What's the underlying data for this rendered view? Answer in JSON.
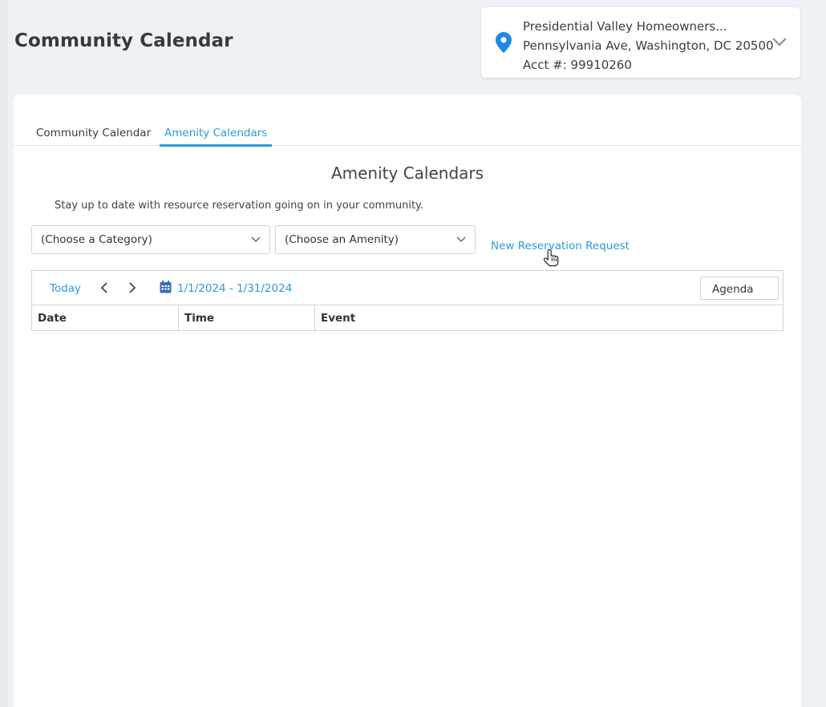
{
  "page": {
    "title": "Community Calendar"
  },
  "account": {
    "name": "Presidential Valley Homeowners...",
    "address": "Pennsylvania Ave, Washington, DC 20500",
    "acct": "Acct #: 99910260",
    "pin_color": "#1e88e5"
  },
  "tabs": [
    {
      "label": "Community Calendar",
      "active": false
    },
    {
      "label": "Amenity Calendars",
      "active": true
    }
  ],
  "main": {
    "section_title": "Amenity Calendars",
    "subtext": "Stay up to date with resource reservation going on in your community.",
    "category_select": "(Choose a Category)",
    "amenity_select": "(Choose an Amenity)",
    "new_request_link": "New Reservation Request"
  },
  "calendar": {
    "today_label": "Today",
    "date_range": "1/1/2024 - 1/31/2024",
    "view_label": "Agenda",
    "columns": [
      "Date",
      "Time",
      "Event"
    ]
  },
  "colors": {
    "accent": "#2c9ad9"
  }
}
